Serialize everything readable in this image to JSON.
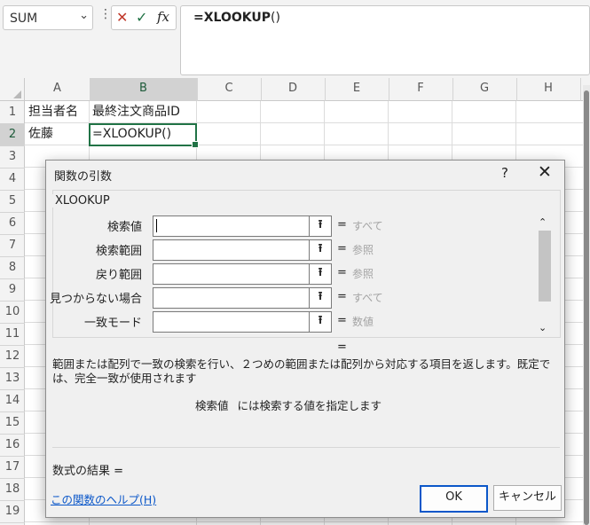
{
  "formula_bar": {
    "name_box": "SUM",
    "cancel_glyph": "✕",
    "enter_glyph": "✓",
    "fx_glyph": "fx",
    "formula_bold": "=XLOOKUP",
    "formula_parens": "()"
  },
  "columns": [
    "A",
    "B",
    "C",
    "D",
    "E",
    "F",
    "G",
    "H"
  ],
  "rows": [
    "1",
    "2",
    "3",
    "4",
    "5",
    "6",
    "7",
    "8",
    "9",
    "10",
    "11",
    "12",
    "13",
    "14",
    "15",
    "16",
    "17",
    "18",
    "19"
  ],
  "cells": {
    "A1": "担当者名",
    "B1": "最終注文商品ID",
    "A2": "佐藤",
    "B2": "=XLOOKUP()"
  },
  "dialog": {
    "title": "関数の引数",
    "help": "?",
    "close": "✕",
    "function_name": "XLOOKUP",
    "arguments": [
      {
        "label": "検索値",
        "value": "すべて"
      },
      {
        "label": "検索範囲",
        "value": "参照"
      },
      {
        "label": "戻り範囲",
        "value": "参照"
      },
      {
        "label": "見つからない場合",
        "value": "すべて"
      },
      {
        "label": "一致モード",
        "value": "数値"
      }
    ],
    "equals": "=",
    "picker_glyph": "⭱",
    "description": "範囲または配列で一致の検索を行い、２つめの範囲または配列から対応する項目を返します。既定では、完全一致が使用されます",
    "arg_name": "検索値",
    "arg_help": "には検索する値を指定します",
    "result_label": "数式の結果 =",
    "help_link": "この関数のヘルプ(H)",
    "ok_label": "OK",
    "cancel_label": "キャンセル"
  },
  "colors": {
    "excel_green": "#217346",
    "link_blue": "#0b57c9",
    "cancel_red": "#c0392b"
  }
}
